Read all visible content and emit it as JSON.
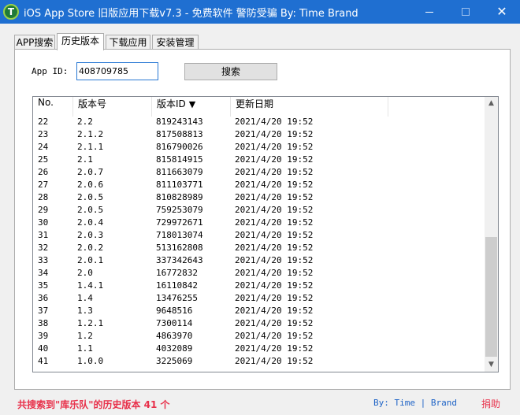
{
  "window": {
    "title": "iOS App Store 旧版应用下载v7.3 - 免费软件 警防受骗 By: Time Brand",
    "icon_letter": "T",
    "close_glyph": "✕"
  },
  "tabs": [
    {
      "label": "APP搜索"
    },
    {
      "label": "历史版本",
      "active": true
    },
    {
      "label": "下载应用"
    },
    {
      "label": "安装管理"
    }
  ],
  "search": {
    "label": "App ID:",
    "value": "408709785",
    "button": "搜索"
  },
  "table": {
    "columns": [
      "No.",
      "版本号",
      "版本ID",
      "更新日期"
    ],
    "sorted_column": "版本ID",
    "sort_icon": "▼",
    "rows": [
      [
        "22",
        "2.2",
        "819243143",
        "2021/4/20 19:52"
      ],
      [
        "23",
        "2.1.2",
        "817508813",
        "2021/4/20 19:52"
      ],
      [
        "24",
        "2.1.1",
        "816790026",
        "2021/4/20 19:52"
      ],
      [
        "25",
        "2.1",
        "815814915",
        "2021/4/20 19:52"
      ],
      [
        "26",
        "2.0.7",
        "811663079",
        "2021/4/20 19:52"
      ],
      [
        "27",
        "2.0.6",
        "811103771",
        "2021/4/20 19:52"
      ],
      [
        "28",
        "2.0.5",
        "810828989",
        "2021/4/20 19:52"
      ],
      [
        "29",
        "2.0.5",
        "759253079",
        "2021/4/20 19:52"
      ],
      [
        "30",
        "2.0.4",
        "729972671",
        "2021/4/20 19:52"
      ],
      [
        "31",
        "2.0.3",
        "718013074",
        "2021/4/20 19:52"
      ],
      [
        "32",
        "2.0.2",
        "513162808",
        "2021/4/20 19:52"
      ],
      [
        "33",
        "2.0.1",
        "337342643",
        "2021/4/20 19:52"
      ],
      [
        "34",
        "2.0",
        "16772832",
        "2021/4/20 19:52"
      ],
      [
        "35",
        "1.4.1",
        "16110842",
        "2021/4/20 19:52"
      ],
      [
        "36",
        "1.4",
        "13476255",
        "2021/4/20 19:52"
      ],
      [
        "37",
        "1.3",
        "9648516",
        "2021/4/20 19:52"
      ],
      [
        "38",
        "1.2.1",
        "7300114",
        "2021/4/20 19:52"
      ],
      [
        "39",
        "1.2",
        "4863970",
        "2021/4/20 19:52"
      ],
      [
        "40",
        "1.1",
        "4032089",
        "2021/4/20 19:52"
      ],
      [
        "41",
        "1.0.0",
        "3225069",
        "2021/4/20 19:52"
      ]
    ]
  },
  "status": {
    "count_text": "共搜索到\"库乐队\"的历史版本 41 个",
    "by_text": "By: Time | Brand",
    "donate": "捐助"
  },
  "colors": {
    "titlebar": "#1f6fd1",
    "accent_red": "#e8304a",
    "link_blue": "#1e63c6"
  }
}
